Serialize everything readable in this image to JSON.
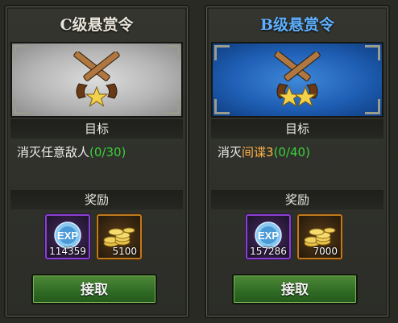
{
  "cards": [
    {
      "title": "C级悬赏令",
      "stars": 1,
      "goal_label": "目标",
      "goal_prefix": "消灭任意敌人",
      "goal_highlight": "",
      "goal_progress": "(0/30)",
      "reward_label": "奖励",
      "exp_icon_text": "EXP",
      "exp_amount": "114359",
      "gold_amount": "5100",
      "accept_label": "接取",
      "banner_color": "#b5b5b5"
    },
    {
      "title": "B级悬赏令",
      "stars": 2,
      "goal_label": "目标",
      "goal_prefix": "消灭",
      "goal_highlight": "间谍3",
      "goal_progress": "(0/40)",
      "reward_label": "奖励",
      "exp_icon_text": "EXP",
      "exp_amount": "157286",
      "gold_amount": "7000",
      "accept_label": "接取",
      "banner_color": "#1f5fb5"
    }
  ],
  "colors": {
    "title_c": "#e8e4d8",
    "title_b": "#5fb0ff",
    "progress": "#3bd13b",
    "highlight": "#ffb347"
  },
  "icons": [
    "crossed-pistols-icon",
    "star-icon",
    "exp-orb-icon",
    "gold-coins-icon"
  ]
}
